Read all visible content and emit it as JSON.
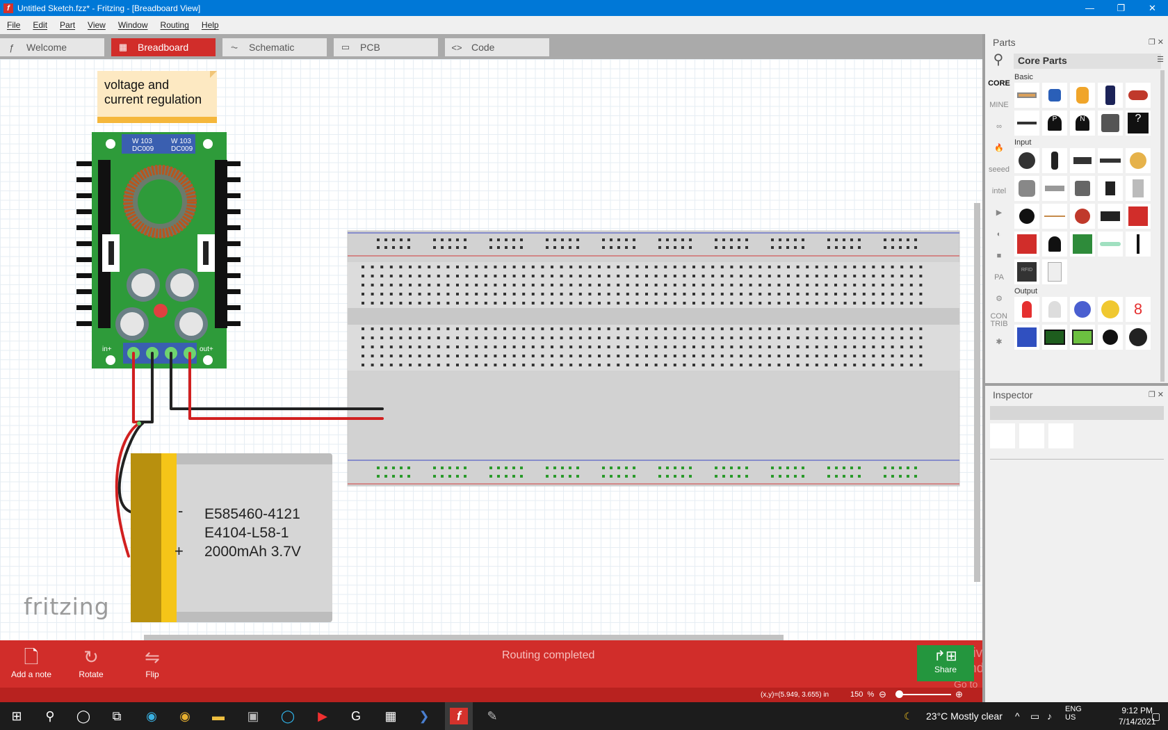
{
  "window": {
    "title": "Untitled Sketch.fzz* - Fritzing - [Breadboard View]",
    "controls": [
      "—",
      "❐",
      "✕"
    ]
  },
  "menu": [
    "File",
    "Edit",
    "Part",
    "View",
    "Window",
    "Routing",
    "Help"
  ],
  "tabs": [
    {
      "label": "Welcome",
      "icon": "fritzing-f-icon",
      "active": false
    },
    {
      "label": "Breadboard",
      "icon": "breadboard-icon",
      "active": true
    },
    {
      "label": "Schematic",
      "icon": "schematic-icon",
      "active": false
    },
    {
      "label": "PCB",
      "icon": "pcb-icon",
      "active": false
    },
    {
      "label": "Code",
      "icon": "code-icon",
      "active": false
    }
  ],
  "canvas": {
    "note_text": "voltage and\ncurrent regulation",
    "converter_labels": [
      "W 103",
      "DC009",
      "W 103",
      "DC009"
    ],
    "converter_in_label": "in+",
    "converter_out_label": "out+",
    "battery_lines": [
      "E585460-4121",
      "E4104-L58-1",
      "2000mAh 3.7V"
    ],
    "battery_minus": "-",
    "battery_plus": "+",
    "logo": "fritzing"
  },
  "toolbar": {
    "add_note": "Add a note",
    "rotate": "Rotate",
    "flip": "Flip",
    "status": "Routing completed",
    "share": "Share"
  },
  "watermark": {
    "line1": "Activate Windows",
    "line2": "Go to Settings to activate Windows."
  },
  "statusbar": {
    "coords": "(x,y)=(5.949, 3.655) in",
    "zoom": "150",
    "zoom_unit": "%"
  },
  "parts": {
    "title": "Parts",
    "bin_title": "Core Parts",
    "bins": [
      "CORE",
      "MINE",
      "∞",
      "🔥",
      "seeed",
      "intel",
      "▶",
      "◐",
      "■",
      "PA",
      "⚙",
      "CON\nTRIB",
      "✱"
    ],
    "categories": [
      "Basic",
      "Input",
      "Output"
    ]
  },
  "inspector": {
    "title": "Inspector"
  },
  "taskbar": {
    "weather": "23°C  Mostly clear",
    "lang_top": "ENG",
    "lang_bottom": "US",
    "time": "9:12 PM",
    "date": "7/14/2021"
  },
  "colors": {
    "accent_red": "#d12d2a",
    "share_green": "#24963e",
    "title_blue": "#0078d7",
    "pcb_green": "#2e9b3a"
  }
}
